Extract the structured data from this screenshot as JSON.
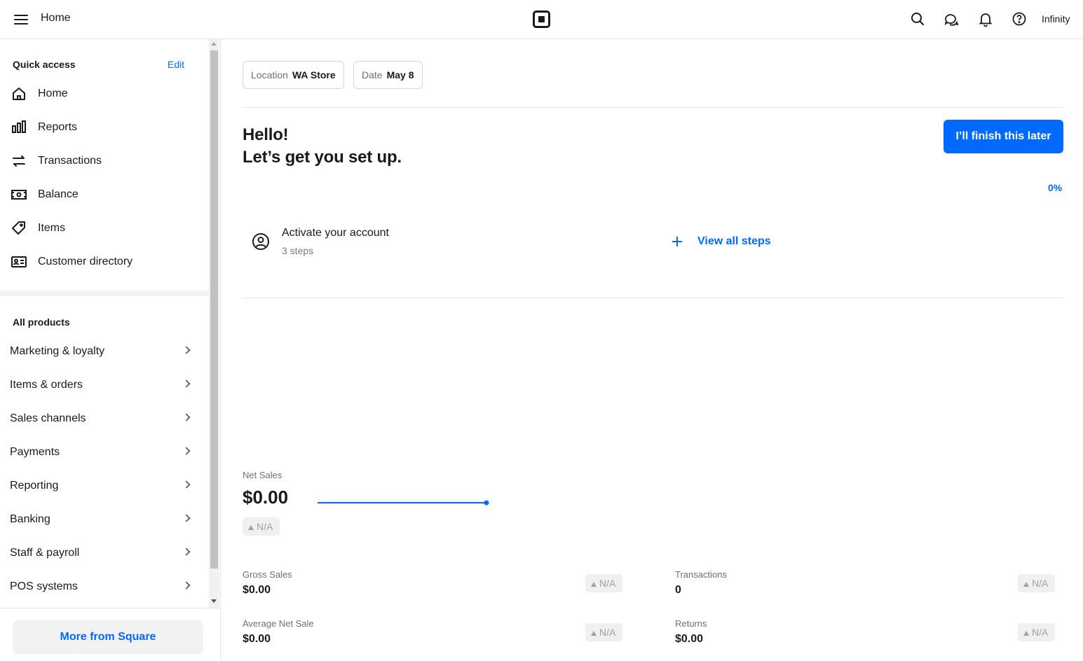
{
  "header": {
    "title": "Home",
    "account_name": "Infinity",
    "icons": [
      "menu-icon",
      "square-logo",
      "search-icon",
      "messages-icon",
      "bell-icon",
      "help-icon"
    ]
  },
  "sidebar": {
    "quick_access_title": "Quick access",
    "edit_label": "Edit",
    "quick_access_items": [
      {
        "label": "Home",
        "icon": "home-icon"
      },
      {
        "label": "Reports",
        "icon": "bar-chart-icon"
      },
      {
        "label": "Transactions",
        "icon": "arrows-swap-icon"
      },
      {
        "label": "Balance",
        "icon": "cash-icon"
      },
      {
        "label": "Items",
        "icon": "tag-icon"
      },
      {
        "label": "Customer directory",
        "icon": "contact-card-icon"
      }
    ],
    "all_products_title": "All products",
    "product_items": [
      {
        "label": "Marketing & loyalty"
      },
      {
        "label": "Items & orders"
      },
      {
        "label": "Sales channels"
      },
      {
        "label": "Payments"
      },
      {
        "label": "Reporting"
      },
      {
        "label": "Banking"
      },
      {
        "label": "Staff & payroll"
      },
      {
        "label": "POS systems"
      }
    ],
    "more_button": "More from Square"
  },
  "filters": {
    "location_key": "Location",
    "location_value": "WA Store",
    "date_key": "Date",
    "date_value": "May 8"
  },
  "setup": {
    "hello": "Hello!",
    "subtitle": "Let’s get you set up.",
    "finish_later": "I’ll finish this later",
    "progress": "0%",
    "step_title": "Activate your account",
    "step_sub": "3 steps",
    "view_all": "View all steps"
  },
  "metrics": {
    "net_sales_label": "Net Sales",
    "net_sales_value": "$0.00",
    "na": "N/A",
    "gross_sales_label": "Gross Sales",
    "gross_sales_value": "$0.00",
    "transactions_label": "Transactions",
    "transactions_value": "0",
    "avg_net_sale_label": "Average Net Sale",
    "avg_net_sale_value": "$0.00",
    "returns_label": "Returns",
    "returns_value": "$0.00"
  },
  "colors": {
    "accent": "#006aff",
    "text": "#1a1a1a",
    "muted": "#6f6f6f",
    "badge_bg": "#f0f0f0"
  }
}
